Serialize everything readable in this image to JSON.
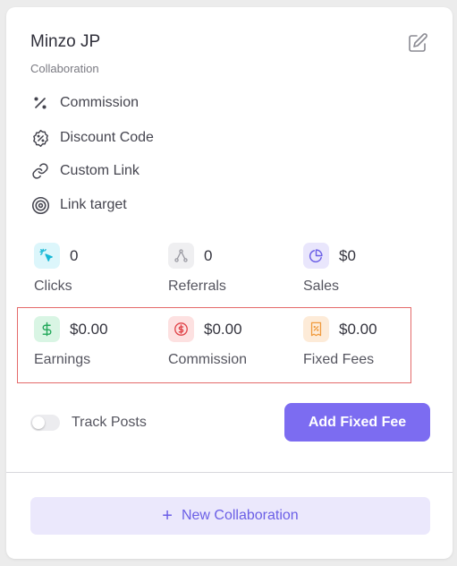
{
  "card": {
    "name": "Minzo JP",
    "type": "Collaboration"
  },
  "attributes": [
    {
      "label": "Commission",
      "icon": "percent-icon"
    },
    {
      "label": "Discount Code",
      "icon": "discount-badge-icon"
    },
    {
      "label": "Custom Link",
      "icon": "link-icon"
    },
    {
      "label": "Link target",
      "icon": "target-icon"
    }
  ],
  "stats_row1": [
    {
      "value": "0",
      "label": "Clicks",
      "icon": "cursor-click-icon",
      "color": "#18b8d6",
      "bg": "#dcf6fb"
    },
    {
      "value": "0",
      "label": "Referrals",
      "icon": "share-nodes-icon",
      "color": "#9a9aa2",
      "bg": "#efeff1"
    },
    {
      "value": "$0",
      "label": "Sales",
      "icon": "pie-chart-icon",
      "color": "#6b5fe6",
      "bg": "#e9e6fc"
    }
  ],
  "stats_row2": [
    {
      "value": "$0.00",
      "label": "Earnings",
      "icon": "dollar-icon",
      "color": "#22a85a",
      "bg": "#d9f5e4"
    },
    {
      "value": "$0.00",
      "label": "Commission",
      "icon": "dollar-circle-icon",
      "color": "#e0454a",
      "bg": "#fde1e1"
    },
    {
      "value": "$0.00",
      "label": "Fixed Fees",
      "icon": "receipt-icon",
      "color": "#f09a3c",
      "bg": "#fdebd8"
    }
  ],
  "toggle": {
    "label": "Track Posts",
    "on": false
  },
  "buttons": {
    "add_fixed_fee": "Add Fixed Fee",
    "new_collaboration": "New Collaboration"
  },
  "colors": {
    "accent": "#7c6cf1",
    "highlight_border": "#e46a6a"
  }
}
